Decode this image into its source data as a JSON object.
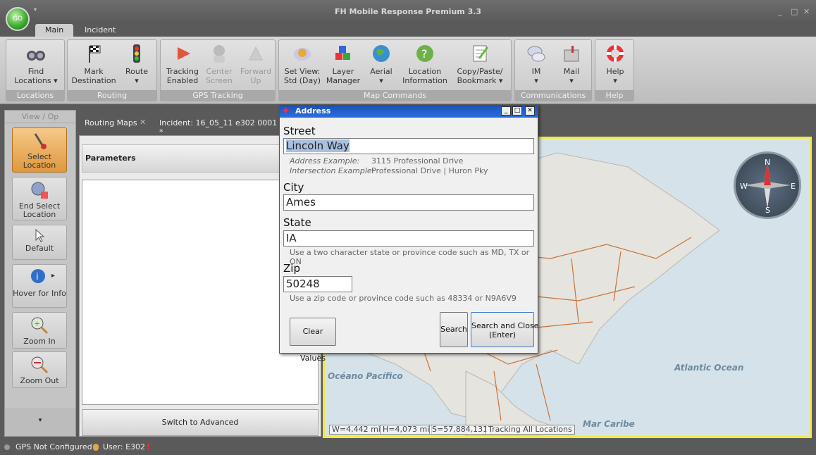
{
  "app": {
    "title": "FH Mobile Response Premium 3.3",
    "orb_label": "GO",
    "qat_glyph": "▾",
    "win_controls": [
      "_",
      "□",
      "✕"
    ]
  },
  "ribbon_tabs": [
    "Main",
    "Incident"
  ],
  "ribbon": {
    "groups": [
      {
        "label": "Locations",
        "buttons": [
          {
            "label": "Find\nLocations ▾",
            "icon": "binoculars-icon",
            "disabled": false
          }
        ]
      },
      {
        "label": "Routing",
        "buttons": [
          {
            "label": "Mark\nDestination",
            "icon": "checkered-flag-icon",
            "disabled": false
          },
          {
            "label": "Route\n▾",
            "icon": "traffic-light-icon",
            "disabled": false
          }
        ]
      },
      {
        "label": "GPS Tracking",
        "buttons": [
          {
            "label": "Tracking\nEnabled",
            "icon": "play-arrow-icon",
            "disabled": false
          },
          {
            "label": "Center\nScreen",
            "icon": "person-icon",
            "disabled": true
          },
          {
            "label": "Forward\nUp",
            "icon": "triangle-icon",
            "disabled": true
          }
        ]
      },
      {
        "label": "Map Commands",
        "buttons": [
          {
            "label": "Set View:\nStd (Day)",
            "icon": "satellite-icon",
            "disabled": false
          },
          {
            "label": "Layer\nManager",
            "icon": "cubes-icon",
            "disabled": false
          },
          {
            "label": "Aerial\n▾",
            "icon": "globe-icon",
            "disabled": false
          },
          {
            "label": "Location\nInformation",
            "icon": "globe-question-icon",
            "disabled": false
          },
          {
            "label": "Copy/Paste/\nBookmark ▾",
            "icon": "notepad-icon",
            "disabled": false
          }
        ]
      },
      {
        "label": "Communications",
        "buttons": [
          {
            "label": "IM\n▾",
            "icon": "chat-bubbles-icon",
            "disabled": false
          },
          {
            "label": "Mail\n▾",
            "icon": "mailbox-icon",
            "disabled": false
          }
        ]
      },
      {
        "label": "Help",
        "buttons": [
          {
            "label": "Help\n▾",
            "icon": "lifebuoy-icon",
            "disabled": false
          }
        ]
      }
    ]
  },
  "left_panel": {
    "header": "View / Op",
    "buttons": [
      {
        "label": "Select\nLocation",
        "icon": "pushpin-select-icon"
      },
      {
        "label": "End Select\nLocation",
        "icon": "gear-stop-icon"
      },
      {
        "label": "Default",
        "icon": "cursor-arrow-icon"
      },
      {
        "label": "Hover for Info",
        "icon": "info-hover-icon"
      },
      {
        "label": "Zoom In",
        "icon": "zoom-in-icon"
      },
      {
        "label": "Zoom Out",
        "icon": "zoom-out-icon"
      }
    ],
    "more_glyph": "▾",
    "hover_arrow": "▸"
  },
  "doc_tabs": [
    {
      "label": "Routing Maps",
      "close": "✕"
    },
    {
      "label": "Incident: 16_05_11 e302 0001 *"
    }
  ],
  "parameters_panel": {
    "header": "Parameters",
    "switch_label": "Switch to Advanced"
  },
  "map": {
    "labels": [
      "Océano Pacífico",
      "Atlantic Ocean",
      "Mar Caribe"
    ],
    "compass": [
      "N",
      "E",
      "S",
      "W"
    ],
    "scale": {
      "w": "W=4,442 mi",
      "h": "H=4,073 mi",
      "s": "S=57,884,131",
      "tracking": "Tracking All Locations"
    }
  },
  "dialog": {
    "title": "Address",
    "street_label": "Street",
    "street_value": "Lincoln Way",
    "address_example_label": "Address Example:",
    "address_example": "3115 Professional Drive",
    "intersection_example_label": "Intersection Example:",
    "intersection_example": "Professional Drive | Huron Pky",
    "city_label": "City",
    "city_value": "Ames",
    "state_label": "State",
    "state_value": "IA",
    "state_hint": "Use a two character state or province code such as MD, TX or ON",
    "zip_label": "Zip",
    "zip_value": "50248",
    "zip_hint": "Use a zip code or province code such as 48334 or N9A6V9",
    "clear_button": "Clear Values",
    "search_button": "Search",
    "search_close_button": "Search and Close\n(Enter)"
  },
  "status_bar": {
    "gps": "GPS Not Configured",
    "user": "User: E302"
  },
  "colors": {
    "highlight_border": "#f0e84a",
    "dialog_title": "#2b6ee0",
    "selected_button": "#e0983c",
    "road_lines": "#c8733b"
  }
}
